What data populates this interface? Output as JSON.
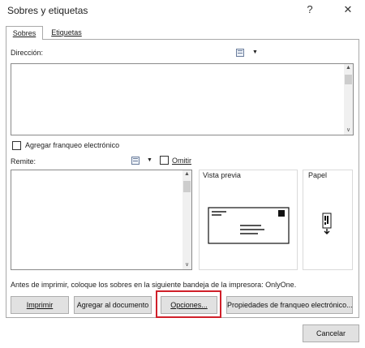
{
  "window": {
    "title": "Sobres y etiquetas",
    "help_glyph": "?",
    "close_glyph": "✕"
  },
  "tabs": [
    {
      "label": "Sobres",
      "active": true
    },
    {
      "label": "Etiquetas",
      "active": false
    }
  ],
  "envelope": {
    "address_label": "Dirección:",
    "postage_label": "Agregar franqueo electrónico",
    "postage_checked": false,
    "return_label": "Remite:",
    "omit_label": "Omitir",
    "omit_checked": false,
    "preview_title": "Vista previa",
    "paper_title": "Papel",
    "info_text": "Antes de imprimir, coloque los sobres en la siguiente bandeja de la impresora: OnlyOne."
  },
  "icons": {
    "address_book": "address-book-icon",
    "dropdown": "chevron-down-icon"
  },
  "buttons": {
    "print": "Imprimir",
    "add_to_document": "Agregar al documento",
    "options": "Opciones...",
    "postage_properties": "Propiedades de franqueo electrónico...",
    "cancel": "Cancelar"
  },
  "scroll_glyphs": {
    "up": "▲",
    "down": "∨"
  },
  "colors": {
    "highlight": "#d0202a",
    "button_face": "#e1e1e1",
    "border": "#a9a9a9"
  }
}
